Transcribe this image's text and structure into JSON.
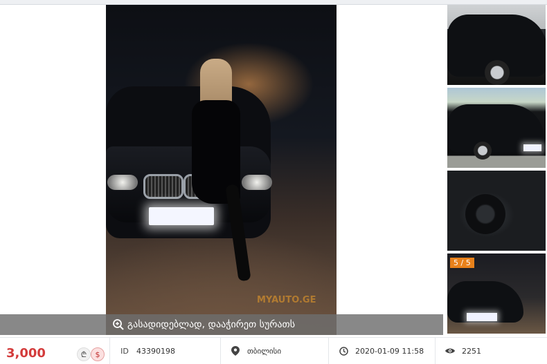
{
  "gallery": {
    "zoom_hint": "გასადიდებლად, დააჭირეთ სურათს",
    "watermark": "MYAUTO.GE",
    "counter": "5 / 5"
  },
  "listing": {
    "price": "3,000",
    "currency_gel": "₾",
    "currency_usd": "$",
    "id_label": "ID",
    "id_value": "43390198",
    "location": "თბილისი",
    "date": "2020-01-09 11:58",
    "views": "2251"
  },
  "colors": {
    "price": "#d33b3b",
    "badge": "#e8811b"
  }
}
